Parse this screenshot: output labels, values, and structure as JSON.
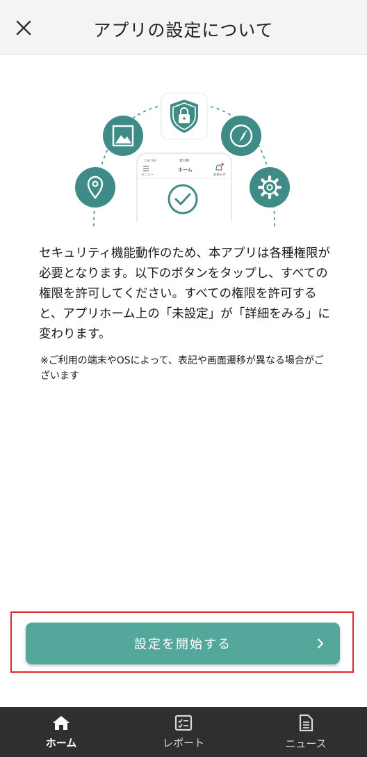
{
  "header": {
    "title": "アプリの設定について",
    "close_icon": "close-icon"
  },
  "illustration": {
    "phone": {
      "carrier": "Carrier",
      "time": "10:00",
      "title": "ホーム",
      "menu_label": "メニュー",
      "notification_label": "お知らせ"
    },
    "icons": [
      "location-icon",
      "image-icon",
      "shield-lock-icon",
      "compass-icon",
      "gear-icon",
      "check-circle-icon"
    ],
    "accent_color": "#3f8c86"
  },
  "description": "セキュリティ機能動作のため、本アプリは各種権限が必要となります。以下のボタンをタップし、すべての権限を許可してください。すべての権限を許可すると、アプリホーム上の「未設定」が「詳細をみる」に変わります。",
  "note": "※ご利用の端末やOSによって、表記や画面遷移が異なる場合がございます",
  "cta": {
    "label": "設定を開始する",
    "color": "#53a79b",
    "highlight_color": "#e0262b"
  },
  "bottom_nav": {
    "items": [
      {
        "label": "ホーム",
        "icon": "home-icon",
        "active": true
      },
      {
        "label": "レポート",
        "icon": "report-icon",
        "active": false
      },
      {
        "label": "ニュース",
        "icon": "news-icon",
        "active": false
      }
    ]
  }
}
